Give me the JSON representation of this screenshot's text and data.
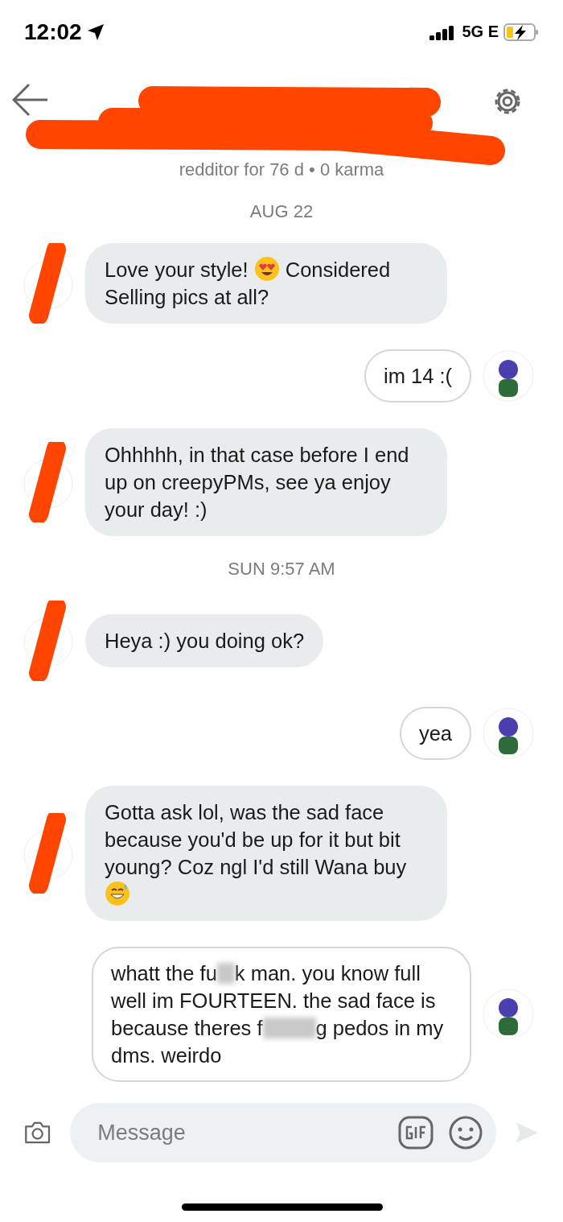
{
  "status_bar": {
    "time": "12:02",
    "network": "5G E",
    "charging": true
  },
  "header": {
    "subtitle": "redditor for 76 d • 0 karma"
  },
  "thread": [
    {
      "kind": "date",
      "text": "AUG 22"
    },
    {
      "kind": "incoming",
      "parts": [
        {
          "kind": "text",
          "text": "Love your style! "
        },
        {
          "kind": "heart_eyes"
        },
        {
          "kind": "text",
          "text": " Considered Selling pics at all?"
        }
      ]
    },
    {
      "kind": "outgoing",
      "parts": [
        {
          "kind": "text",
          "text": "im 14 :("
        }
      ]
    },
    {
      "kind": "incoming",
      "parts": [
        {
          "kind": "text",
          "text": "Ohhhhh, in that case before I end up on creepyPMs, see ya enjoy your day! :)"
        }
      ]
    },
    {
      "kind": "date",
      "text": "SUN 9:57 AM"
    },
    {
      "kind": "incoming",
      "parts": [
        {
          "kind": "text",
          "text": "Heya :) you doing ok?"
        }
      ]
    },
    {
      "kind": "outgoing",
      "parts": [
        {
          "kind": "text",
          "text": "yea"
        }
      ]
    },
    {
      "kind": "incoming",
      "parts": [
        {
          "kind": "text",
          "text": "Gotta ask lol, was the sad face because you'd be up for it but bit young? Coz ngl I'd still Wana buy "
        },
        {
          "kind": "sweat_smile"
        }
      ]
    },
    {
      "kind": "outgoing",
      "parts": [
        {
          "kind": "text",
          "text": "whatt the fu"
        },
        {
          "kind": "blur_short"
        },
        {
          "kind": "text",
          "text": "k man. you know full well im FOURTEEN. the sad face is because theres f"
        },
        {
          "kind": "blur_long"
        },
        {
          "kind": "text",
          "text": "g pedos in my dms. weirdo"
        }
      ]
    }
  ],
  "composer": {
    "placeholder": "Message"
  }
}
